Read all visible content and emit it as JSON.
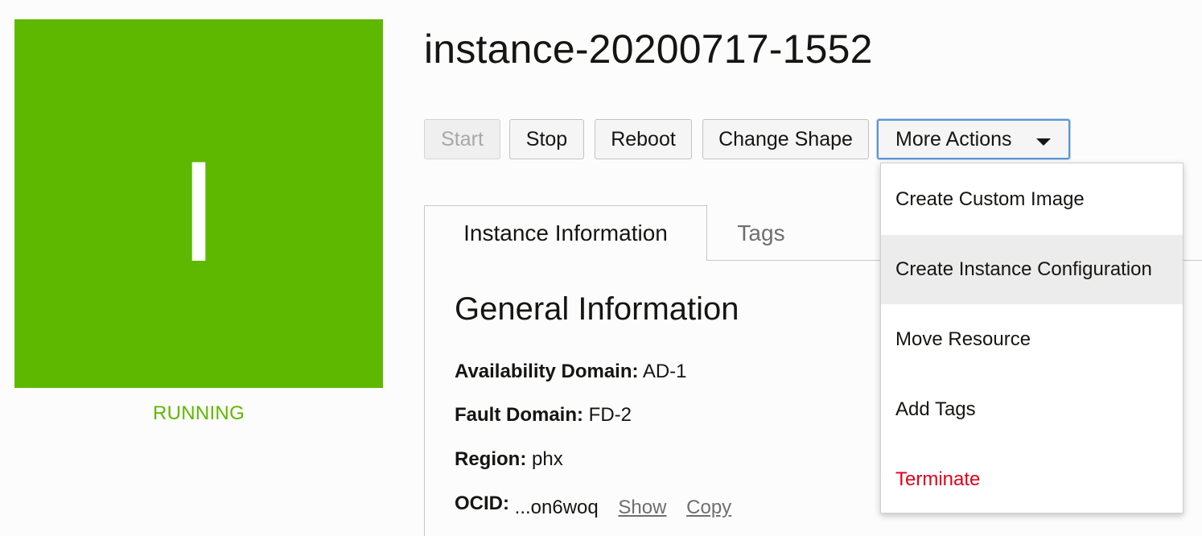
{
  "instance": {
    "icon_letter": "I",
    "status": "RUNNING",
    "status_color": "#5eb800",
    "name": "instance-20200717-1552"
  },
  "toolbar": {
    "start_label": "Start",
    "stop_label": "Stop",
    "reboot_label": "Reboot",
    "change_shape_label": "Change Shape",
    "more_actions_label": "More Actions"
  },
  "tabs": {
    "instance_information": "Instance Information",
    "tags": "Tags"
  },
  "general": {
    "title": "General Information",
    "availability_domain_label": "Availability Domain:",
    "availability_domain_value": "AD-1",
    "fault_domain_label": "Fault Domain:",
    "fault_domain_value": "FD-2",
    "region_label": "Region:",
    "region_value": "phx",
    "ocid_label": "OCID:",
    "ocid_value": "...on6woq",
    "show_label": "Show",
    "copy_label": "Copy"
  },
  "more_actions_menu": {
    "items": [
      {
        "label": "Create Custom Image"
      },
      {
        "label": "Create Instance Configuration"
      },
      {
        "label": "Move Resource"
      },
      {
        "label": "Add Tags"
      },
      {
        "label": "Terminate"
      }
    ],
    "danger_color": "#e0001b"
  }
}
